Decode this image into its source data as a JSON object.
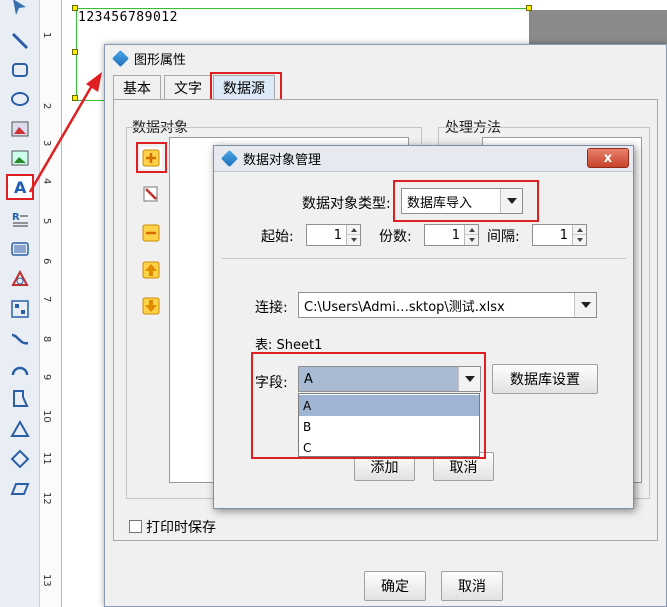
{
  "canvas": {
    "text": "123456789012"
  },
  "ruler": {
    "numbers": [
      "1",
      "2",
      "3",
      "4",
      "5",
      "6",
      "7",
      "8",
      "9",
      "10",
      "11",
      "12",
      "13"
    ]
  },
  "dialog": {
    "title": "图形属性",
    "tabs": [
      "基本",
      "文字",
      "数据源"
    ],
    "selected_tab": "数据源",
    "data_object_label": "数据对象",
    "process_label": "处理方法",
    "print_save_label": "打印时保存",
    "ok_label": "确定",
    "cancel_label": "取消"
  },
  "sub_dialog": {
    "title": "数据对象管理",
    "close_label": "x",
    "type_label": "数据对象类型:",
    "type_value": "数据库导入",
    "start_label": "起始:",
    "start_value": "1",
    "copies_label": "份数:",
    "copies_value": "1",
    "interval_label": "间隔:",
    "interval_value": "1",
    "connection_label": "连接:",
    "connection_value": "C:\\Users\\Admi…sktop\\测试.xlsx",
    "table_label": "表: Sheet1",
    "field_label": "字段:",
    "field_value": "A",
    "field_options": [
      "A",
      "B",
      "C"
    ],
    "db_settings_label": "数据库设置",
    "add_label": "添加",
    "cancel_label": "取消"
  },
  "colors": {
    "highlight": "#e02020",
    "accent": "#1f6fb8",
    "selected_option": "#9fb4d2"
  }
}
